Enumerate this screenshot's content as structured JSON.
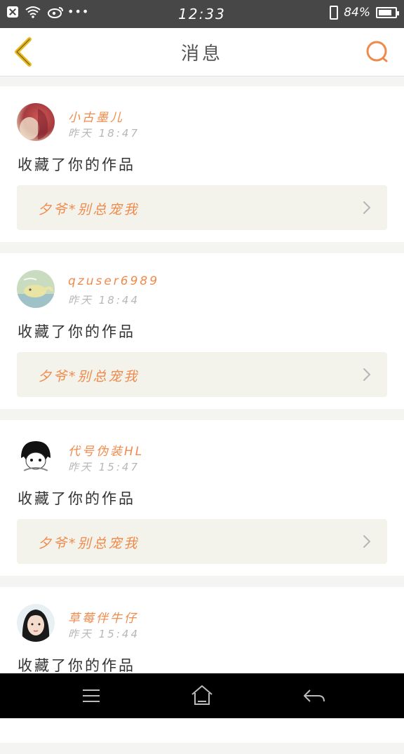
{
  "status_bar": {
    "time": "12:33",
    "battery_percent_text": "84%",
    "battery_level": 0.84,
    "icons": [
      "close-icon",
      "wifi-icon",
      "weibo-icon",
      "more-dots-icon",
      "phone-vibrate-icon",
      "battery-icon"
    ]
  },
  "header": {
    "title": "消息",
    "back_icon": "chevron-left-icon",
    "search_icon": "search-icon",
    "accent_color": "#f08a4b",
    "back_color": "#e8b820"
  },
  "messages": [
    {
      "username": "小古墨儿",
      "time": "昨天 18:47",
      "action": "收藏了你的作品",
      "work_title": "夕爷*别总宠我",
      "avatar": "avatar-red-hair"
    },
    {
      "username": "qzuser6989",
      "time": "昨天 18:44",
      "action": "收藏了你的作品",
      "work_title": "夕爷*别总宠我",
      "avatar": "avatar-whale"
    },
    {
      "username": "代号伪装HL",
      "time": "昨天 15:47",
      "action": "收藏了你的作品",
      "work_title": "夕爷*别总宠我",
      "avatar": "avatar-anime-boy"
    },
    {
      "username": "草莓伴牛仔",
      "time": "昨天 15:44",
      "action": "收藏了你的作品",
      "work_title": "",
      "avatar": "avatar-girl"
    }
  ],
  "nav_bar": {
    "icons": [
      "menu-icon",
      "home-icon",
      "back-arrow-icon"
    ]
  }
}
